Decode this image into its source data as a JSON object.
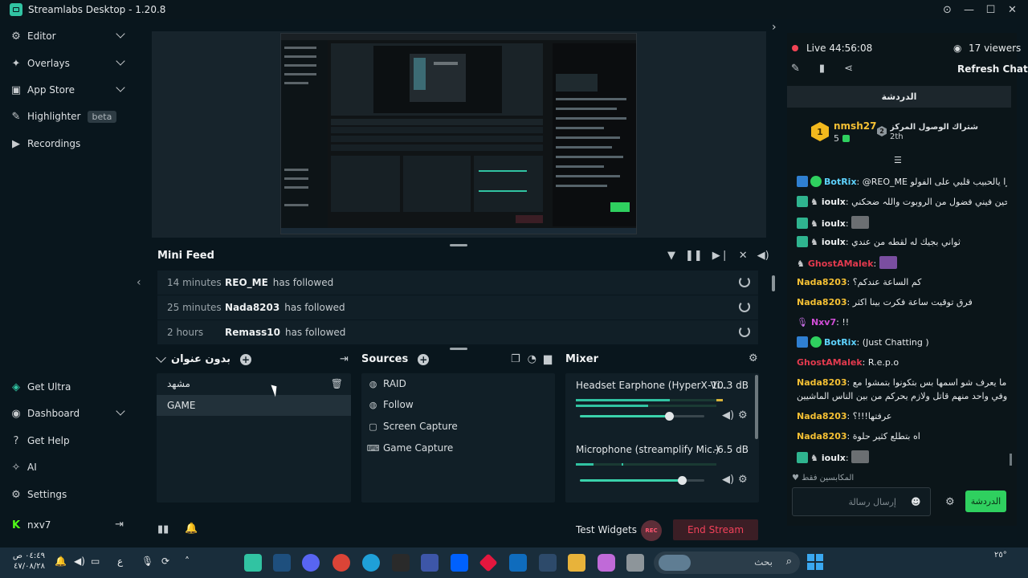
{
  "window": {
    "title": "Streamlabs Desktop - 1.20.8"
  },
  "sidebar": {
    "top_items": [
      {
        "label": "Editor",
        "icon": "editor-icon",
        "glyph": "⚙",
        "chevron": true
      },
      {
        "label": "Overlays",
        "icon": "overlays-icon",
        "glyph": "✦",
        "chevron": true
      },
      {
        "label": "App Store",
        "icon": "app-store-icon",
        "glyph": "▣",
        "chevron": true
      },
      {
        "label": "Highlighter",
        "icon": "highlighter-icon",
        "glyph": "✎",
        "chevron": false,
        "badge": "beta"
      },
      {
        "label": "Recordings",
        "icon": "recordings-icon",
        "glyph": "▶",
        "chevron": false
      }
    ],
    "bottom_items": [
      {
        "label": "Get Ultra",
        "icon": "ultra-icon",
        "glyph": "◈"
      },
      {
        "label": "Dashboard",
        "icon": "dashboard-icon",
        "glyph": "◉",
        "chevron": true
      },
      {
        "label": "Get Help",
        "icon": "help-icon",
        "glyph": "?"
      },
      {
        "label": "AI",
        "icon": "ai-icon",
        "glyph": "✧"
      },
      {
        "label": "Settings",
        "icon": "settings-icon",
        "glyph": "⚙"
      }
    ],
    "user": {
      "name": "nxv7"
    }
  },
  "mini_feed": {
    "title": "Mini Feed",
    "rows": [
      {
        "time": "14 minutes",
        "name": "REO_ME",
        "action": "has followed"
      },
      {
        "time": "25 minutes",
        "name": "Nada8203",
        "action": "has followed"
      },
      {
        "time": "2 hours",
        "name": "Remass10",
        "action": "has followed"
      }
    ]
  },
  "scenes": {
    "title": "بدون عنوان",
    "items": [
      "مشهد",
      "GAME"
    ]
  },
  "sources": {
    "title": "Sources",
    "items": [
      {
        "label": "RAID",
        "icon": "globe-icon",
        "glyph": "◍"
      },
      {
        "label": "Follow",
        "icon": "globe-icon",
        "glyph": "◍"
      },
      {
        "label": "Screen Capture",
        "icon": "screen-capture-icon",
        "glyph": "▢"
      },
      {
        "label": "Game Capture",
        "icon": "gamepad-icon",
        "glyph": "⌨"
      }
    ]
  },
  "mixer": {
    "title": "Mixer",
    "channels": [
      {
        "name": "Headset Earphone (HyperX Vi...",
        "db": "-10.3 dB",
        "level": 0.72
      },
      {
        "name": "Microphone (streamplify Mic.)",
        "db": "-6.5 dB",
        "level": 0.83
      }
    ]
  },
  "bottom_bar": {
    "test_widgets": "Test Widgets",
    "rec": "REC",
    "end_stream": "End Stream"
  },
  "chat": {
    "live_label": "Live 44:56:08",
    "viewers": "17 viewers",
    "refresh": "Refresh Chat",
    "header": "الدردشة",
    "top_donor": {
      "name": "nmsh27",
      "count": "5",
      "rank1": "1",
      "rank2": "2",
      "second_text": "إهداء 1 اشتراك الوصول المركز",
      "second_place": "2th"
    },
    "messages": [
      {
        "user": "BotRix",
        "cls": "u-green",
        "text": "@REO_ME شكرا يالحبيب قلبي على الفولو"
      },
      {
        "user": "ioulx",
        "cls": "u-white",
        "text": "للحين فيني فضول من الروبوت واللہ ضحكني"
      },
      {
        "user": "ioulx",
        "cls": "u-white",
        "text": ""
      },
      {
        "user": "ioulx",
        "cls": "u-white",
        "text": "ثواني بجيك له لقطه من عندي"
      },
      {
        "user": "GhostAMalek",
        "cls": "u-red",
        "text": ""
      },
      {
        "user": "Nada8203",
        "cls": "u-gold",
        "text": "كم الساعة عندكم؟"
      },
      {
        "user": "Nada8203",
        "cls": "u-gold",
        "text": "فرق توقيت ساعة فكرت بينا اكثر"
      },
      {
        "user": "Nxv7",
        "cls": "u-pink",
        "text": "!!"
      },
      {
        "user": "BotRix",
        "cls": "u-green",
        "text": "(Just Chatting )"
      },
      {
        "user": "GhostAMalek",
        "cls": "u-red",
        "text": "R.e.p.o"
      },
      {
        "user": "Nada8203",
        "cls": "u-gold",
        "text": "في لعبة ما يعرف شو اسمها بس بتكونوا بتمشوا مع"
      },
      {
        "user": "",
        "cls": "u-white",
        "text": "ناس وفي واحد منهم قاتل ولازم يحركم من بين الناس الماشيين"
      },
      {
        "user": "Nada8203",
        "cls": "u-gold",
        "text": "عرفتها!!!؟"
      },
      {
        "user": "Nada8203",
        "cls": "u-gold",
        "text": "اه بتطلع كثير حلوة"
      },
      {
        "user": "ioulx",
        "cls": "u-white",
        "text": ""
      }
    ],
    "mods_only": "المكابسين فقط",
    "input_placeholder": "إرسال رسالة",
    "send_button": "الدردشة"
  },
  "taskbar": {
    "time": "٠٤:٤٩ ص",
    "date": "٤٧/٠٨/٢٨",
    "search_placeholder": "بحث",
    "lang": "ع",
    "weather": "٢٥°"
  }
}
